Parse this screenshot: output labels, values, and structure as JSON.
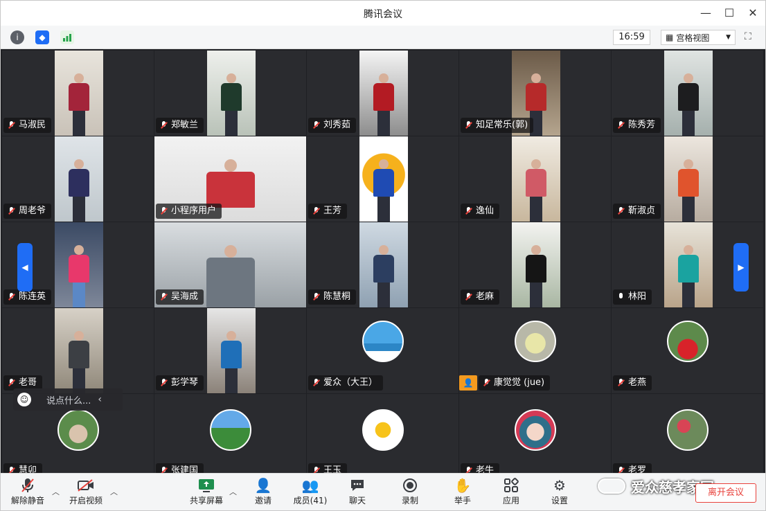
{
  "window": {
    "title": "腾讯会议"
  },
  "infobar": {
    "time": "16:59",
    "view_label": "宫格视图"
  },
  "participants": [
    {
      "name": "马淑民",
      "muted": true
    },
    {
      "name": "郑敏兰",
      "muted": true
    },
    {
      "name": "刘秀茹",
      "muted": true
    },
    {
      "name": "知足常乐(郭)",
      "muted": true
    },
    {
      "name": "陈秀芳",
      "muted": true
    },
    {
      "name": "周老爷",
      "muted": true
    },
    {
      "name": "小程序用户",
      "muted": true
    },
    {
      "name": "王芳",
      "muted": true
    },
    {
      "name": "逸仙",
      "muted": true
    },
    {
      "name": "靳淑贞",
      "muted": true
    },
    {
      "name": "陈连英",
      "muted": true
    },
    {
      "name": "吴海成",
      "muted": true
    },
    {
      "name": "陈慧桐",
      "muted": true
    },
    {
      "name": "老麻",
      "muted": true
    },
    {
      "name": "林阳",
      "muted": false
    },
    {
      "name": "老哥",
      "muted": true
    },
    {
      "name": "彭学琴",
      "muted": true
    },
    {
      "name": "爱众（大王）",
      "muted": true
    },
    {
      "name": "康觉觉 (jue)",
      "muted": true
    },
    {
      "name": "老燕",
      "muted": true
    },
    {
      "name": "慧卯",
      "muted": true
    },
    {
      "name": "张建国",
      "muted": true
    },
    {
      "name": "王玉",
      "muted": true
    },
    {
      "name": "老牛",
      "muted": true
    },
    {
      "name": "老罗",
      "muted": true
    }
  ],
  "chat": {
    "placeholder": "说点什么..."
  },
  "toolbar": {
    "unmute": "解除静音",
    "video": "开启视频",
    "share": "共享屏幕",
    "invite": "邀请",
    "members": "成员(41)",
    "chat": "聊天",
    "record": "录制",
    "raise": "举手",
    "apps": "应用",
    "settings": "设置",
    "leave": "离开会议"
  },
  "watermark": "爱众慈孝家园",
  "colors": {
    "accent": "#1f6df5",
    "muted": "#e8413b",
    "tile": "#2a2b2f",
    "badge": "#f39a1f"
  }
}
